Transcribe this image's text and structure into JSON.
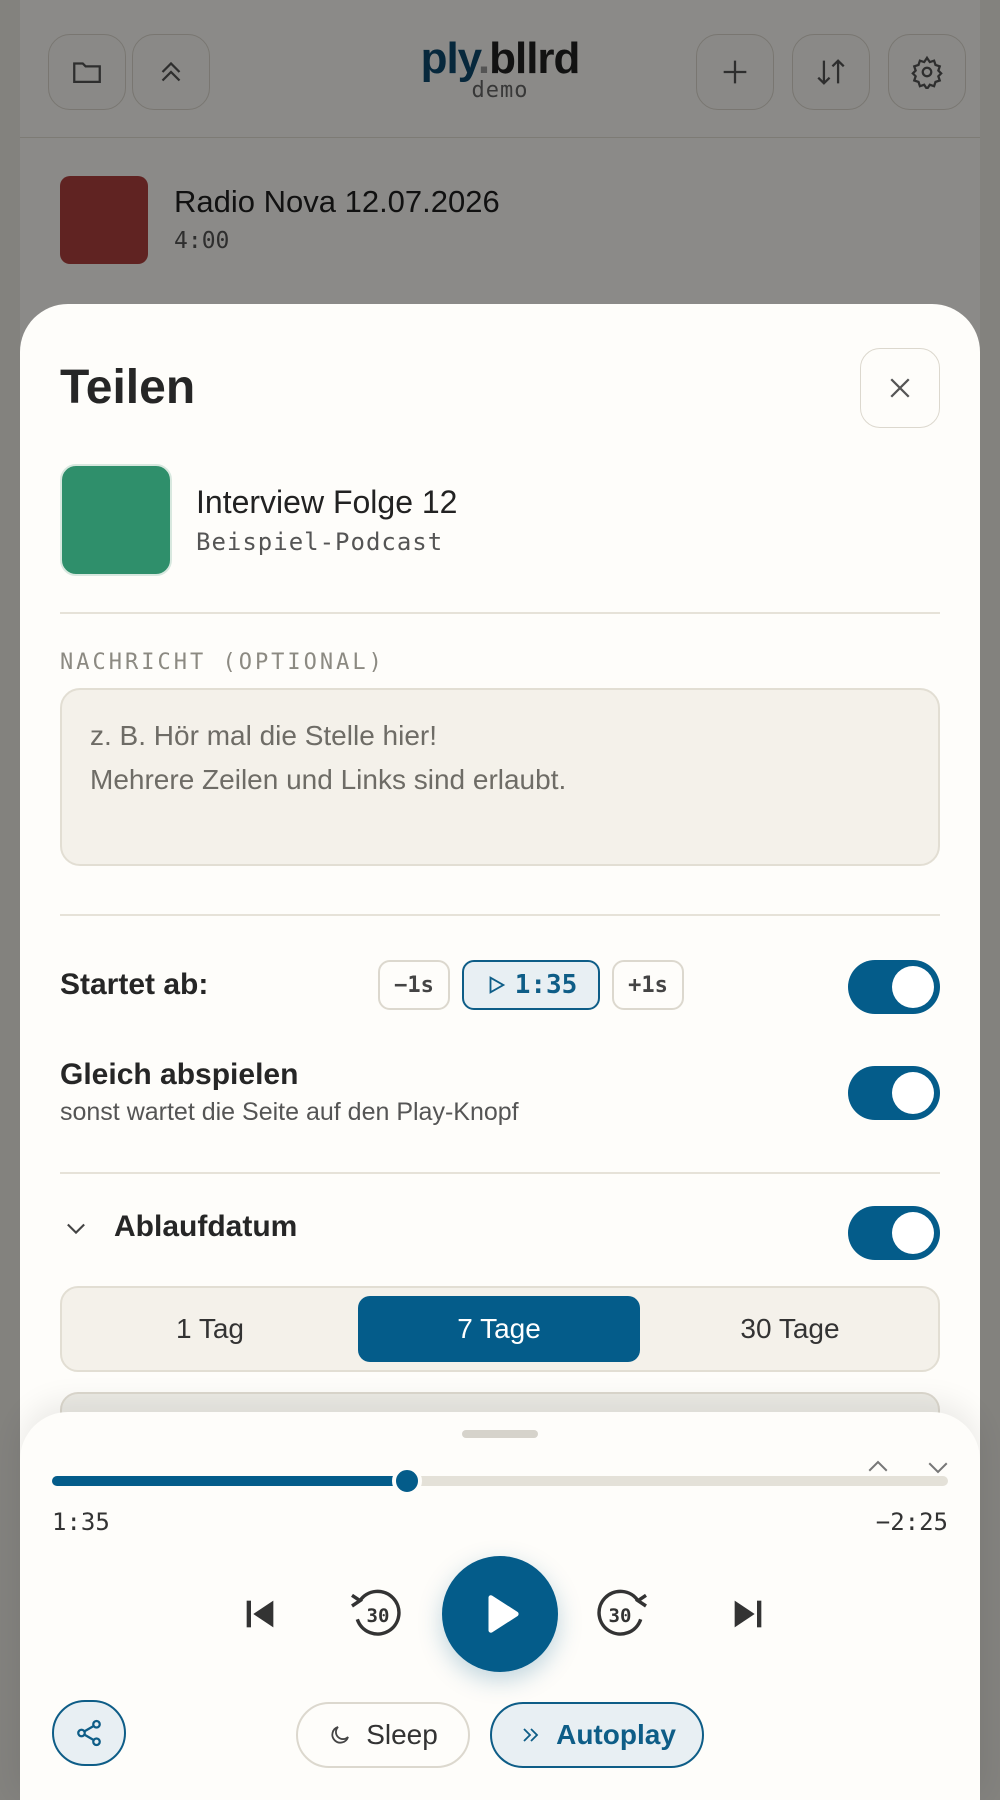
{
  "app": {
    "logo_ply": "ply",
    "logo_dot": ".",
    "logo_rest": "bllrd",
    "logo_sub": "demo",
    "toolbar_icons": [
      "folder-icon",
      "chevrons-up-icon",
      "plus-icon",
      "sort-icon",
      "gear-icon"
    ],
    "list": [
      {
        "title": "Radio Nova 12.07.2026",
        "duration": "4:00",
        "thumb_color": "#b0413e"
      }
    ]
  },
  "share": {
    "title": "Teilen",
    "episode": {
      "title": "Interview Folge 12",
      "podcast": "Beispiel-Podcast",
      "thumb_color": "#2f8f6b"
    },
    "message_label": "NACHRICHT (OPTIONAL)",
    "message_placeholder": "z. B. Hör mal die Stelle hier!\nMehrere Zeilen und Links sind erlaubt.",
    "start_label": "Startet ab:",
    "minus_label": "−1s",
    "time_label": "1:35",
    "plus_label": "+1s",
    "start_enabled": true,
    "autoplay_label": "Gleich abspielen",
    "autoplay_sub": "sonst wartet die Seite auf den Play-Knopf",
    "autoplay_enabled": true,
    "expiry_label": "Ablaufdatum",
    "expiry_enabled": true,
    "expiry_options": [
      "1 Tag",
      "7 Tage",
      "30 Tage"
    ],
    "expiry_selected": "7 Tage"
  },
  "player": {
    "current": "1:35",
    "remaining": "−2:25",
    "progress": 0.3958,
    "skip_back": "30",
    "skip_fwd": "30",
    "sleep_label": "Sleep",
    "autoplay_label": "Autoplay",
    "accent": "#045c8a"
  }
}
